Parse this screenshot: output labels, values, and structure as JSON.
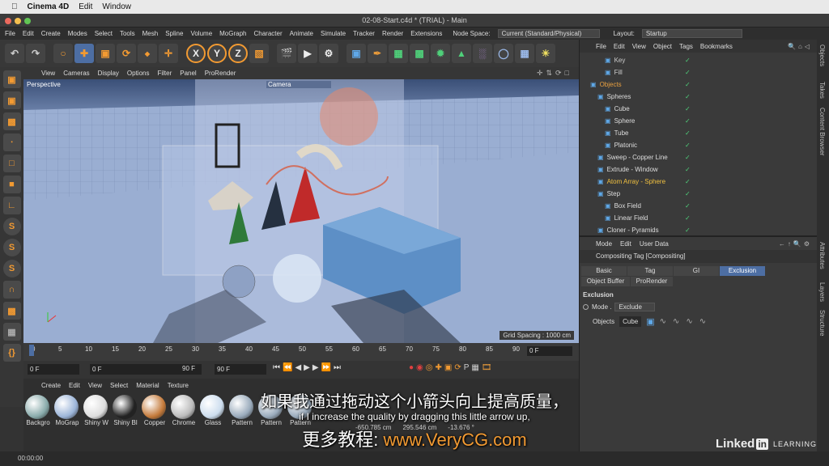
{
  "mac": {
    "app": "Cinema 4D",
    "menus": [
      "Edit",
      "Window"
    ]
  },
  "window_title": "02-08-Start.c4d * (TRIAL) - Main",
  "menubar": {
    "items": [
      "File",
      "Edit",
      "Create",
      "Modes",
      "Select",
      "Tools",
      "Mesh",
      "Spline",
      "Volume",
      "MoGraph",
      "Character",
      "Animate",
      "Simulate",
      "Tracker",
      "Render",
      "Extensions"
    ],
    "node_space_label": "Node Space:",
    "node_space_value": "Current (Standard/Physical)",
    "layout_label": "Layout:",
    "layout_value": "Startup"
  },
  "toolbar": {
    "axis_x": "X",
    "axis_y": "Y",
    "axis_z": "Z"
  },
  "viewport": {
    "menus": [
      "View",
      "Cameras",
      "Display",
      "Options",
      "Filter",
      "Panel",
      "ProRender"
    ],
    "label": "Perspective",
    "camera_tag": "Camera",
    "grid_spacing": "Grid Spacing : 1000 cm"
  },
  "timeline": {
    "ticks": [
      "0",
      "5",
      "10",
      "15",
      "20",
      "25",
      "30",
      "35",
      "40",
      "45",
      "50",
      "55",
      "60",
      "65",
      "70",
      "75",
      "80",
      "85",
      "90"
    ],
    "current_frame": "0 F"
  },
  "transport": {
    "start": "0 F",
    "current": "0 F",
    "end_a": "90 F",
    "end_b": "90 F"
  },
  "material": {
    "menus": [
      "Create",
      "Edit",
      "View",
      "Select",
      "Material",
      "Texture"
    ],
    "items": [
      "Backgro",
      "MoGrap",
      "Shiny W",
      "Shiny Bl",
      "Copper",
      "Chrome",
      "Glass",
      "Pattern",
      "Pattern",
      "Pattern"
    ],
    "coord_x": "-650.785 cm",
    "coord_y": "295.546 cm",
    "coord_z": "-13.676 °"
  },
  "status": {
    "time": "00:00:00"
  },
  "objects": {
    "menus": [
      "File",
      "Edit",
      "View",
      "Object",
      "Tags",
      "Bookmarks"
    ],
    "rows": [
      {
        "name": "Key",
        "indent": 3,
        "color": "#ccc"
      },
      {
        "name": "Fill",
        "indent": 3,
        "color": "#ccc"
      },
      {
        "name": "Objects",
        "indent": 1,
        "color": "#e8a040"
      },
      {
        "name": "Spheres",
        "indent": 2,
        "color": "#ddd"
      },
      {
        "name": "Cube",
        "indent": 3,
        "color": "#ddd"
      },
      {
        "name": "Sphere",
        "indent": 3,
        "color": "#ddd"
      },
      {
        "name": "Tube",
        "indent": 3,
        "color": "#ddd"
      },
      {
        "name": "Platonic",
        "indent": 3,
        "color": "#ddd"
      },
      {
        "name": "Sweep - Copper Line",
        "indent": 2,
        "color": "#ddd"
      },
      {
        "name": "Extrude - Window",
        "indent": 2,
        "color": "#ddd"
      },
      {
        "name": "Atom Array - Sphere",
        "indent": 2,
        "color": "#f0c040"
      },
      {
        "name": "Step",
        "indent": 2,
        "color": "#ddd"
      },
      {
        "name": "Box Field",
        "indent": 3,
        "color": "#ddd"
      },
      {
        "name": "Linear Field",
        "indent": 3,
        "color": "#ddd"
      },
      {
        "name": "Cloner - Pyramids",
        "indent": 2,
        "color": "#ddd"
      }
    ]
  },
  "attributes": {
    "menus": [
      "Mode",
      "Edit",
      "User Data"
    ],
    "tag_title": "Compositing Tag [Compositing]",
    "tabs": [
      "Basic",
      "Tag",
      "GI",
      "Exclusion",
      "Object Buffer",
      "ProRender"
    ],
    "section": "Exclusion",
    "mode_label": "Mode .",
    "mode_value": "Exclude",
    "objects_label": "Objects",
    "objects_value": "Cube"
  },
  "side_tabs": {
    "top": [
      "Objects",
      "Takes",
      "Content Browser"
    ],
    "bottom": [
      "Attributes",
      "Layers",
      "Structure"
    ]
  },
  "subtitles": {
    "zh1": "如果我通过拖动这个小箭头向上提高质量，",
    "en": "if I increase the quality by dragging this little arrow up,",
    "zh2_prefix": "更多教程: ",
    "zh2_url": "www.VeryCG.com"
  },
  "brand": {
    "logo_a": "Linked",
    "logo_b": "in",
    "learning": "LEARNING"
  }
}
